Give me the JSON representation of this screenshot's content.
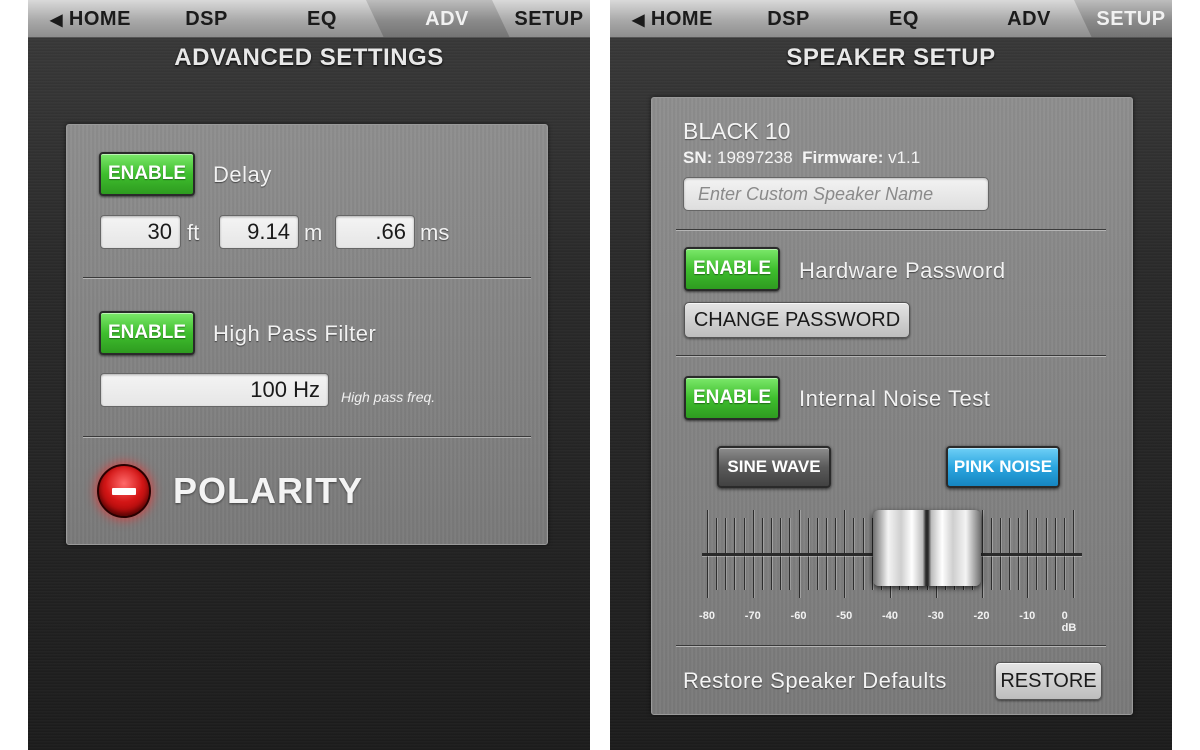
{
  "left": {
    "nav": {
      "home": "HOME",
      "dsp": "DSP",
      "eq": "EQ",
      "adv": "ADV",
      "setup": "SETUP"
    },
    "title": "ADVANCED SETTINGS",
    "delay": {
      "enable_label": "ENABLE",
      "label": "Delay",
      "ft_value": "30",
      "ft_unit": "ft",
      "m_value": "9.14",
      "m_unit": "m",
      "ms_value": ".66",
      "ms_unit": "ms"
    },
    "hpf": {
      "enable_label": "ENABLE",
      "label": "High Pass Filter",
      "freq_value": "100 Hz",
      "hint": "High pass freq."
    },
    "polarity": {
      "label": "POLARITY",
      "state_color": "#d31616"
    }
  },
  "right": {
    "nav": {
      "home": "HOME",
      "dsp": "DSP",
      "eq": "EQ",
      "adv": "ADV",
      "setup": "SETUP"
    },
    "title": "SPEAKER SETUP",
    "speaker": {
      "model": "BLACK 10",
      "sn_label": "SN:",
      "sn_value": "19897238",
      "fw_label": "Firmware:",
      "fw_value": "v1.1",
      "name_placeholder": "Enter Custom Speaker Name"
    },
    "password": {
      "enable_label": "ENABLE",
      "label": "Hardware Password",
      "change_button": "CHANGE PASSWORD"
    },
    "noise_test": {
      "enable_label": "ENABLE",
      "label": "Internal Noise Test",
      "sine_button": "SINE WAVE",
      "pink_button": "PINK NOISE",
      "selected": "PINK NOISE",
      "level_db": -32,
      "scale_labels": [
        "-80",
        "-70",
        "-60",
        "-50",
        "-40",
        "-30",
        "-20",
        "-10",
        "0 dB"
      ]
    },
    "restore": {
      "label": "Restore Speaker Defaults",
      "button": "RESTORE"
    },
    "colors": {
      "enable_green": "#3fbf2e",
      "pink_noise_blue": "#2ba6e0"
    }
  }
}
